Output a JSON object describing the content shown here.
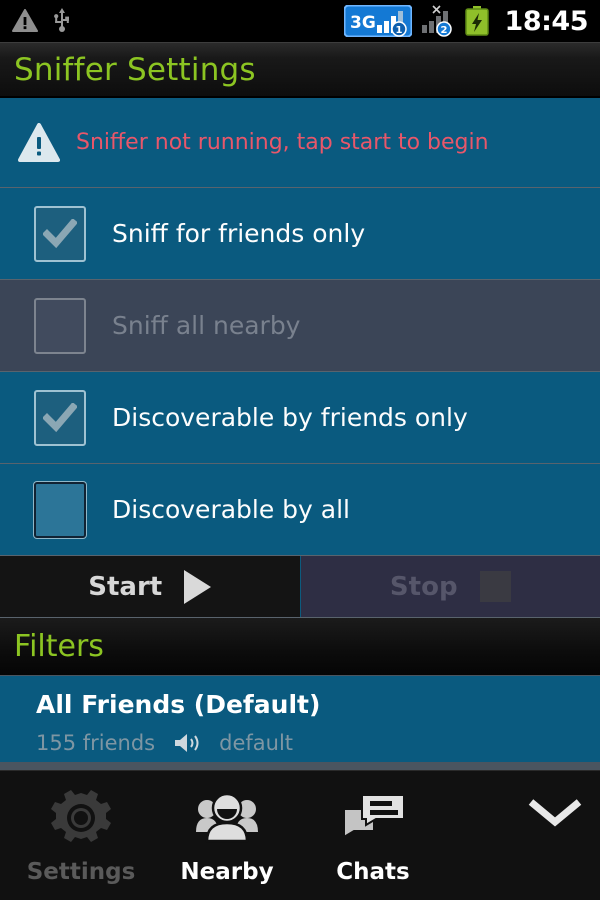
{
  "statusbar": {
    "left_icons": [
      {
        "name": "warning-icon",
        "glyph": "warning-triangle"
      },
      {
        "name": "usb-icon",
        "glyph": "usb"
      }
    ],
    "right_icons": [
      {
        "name": "signal-3g-sim1-icon",
        "label": "3G",
        "sim": "1"
      },
      {
        "name": "signal-sim2-no-service-icon",
        "label": "",
        "sim": "2"
      },
      {
        "name": "battery-charging-icon",
        "label": ""
      }
    ],
    "clock": "18:45"
  },
  "titlebar": {
    "title": "Sniffer Settings",
    "accent_color": "#8cc522"
  },
  "warning_row": {
    "icon": "alert-triangle-icon",
    "message": "Sniffer not running, tap start to begin",
    "color": "#e8576a"
  },
  "options": [
    {
      "id": "sniff-friends-only",
      "label": "Sniff for friends only",
      "checked": true,
      "enabled": true
    },
    {
      "id": "sniff-all-nearby",
      "label": "Sniff all nearby",
      "checked": false,
      "enabled": false
    },
    {
      "id": "discoverable-friends-only",
      "label": "Discoverable by friends only",
      "checked": true,
      "enabled": true
    },
    {
      "id": "discoverable-by-all",
      "label": "Discoverable by all",
      "checked": false,
      "enabled": true
    }
  ],
  "controls": {
    "start_label": "Start",
    "start_enabled": true,
    "stop_label": "Stop",
    "stop_enabled": false
  },
  "filters": {
    "section_title": "Filters",
    "items": [
      {
        "title": "All Friends (Default)",
        "count_text": "155 friends",
        "sound_icon": "speaker-icon",
        "sound_text": "default"
      }
    ]
  },
  "navbar": {
    "items": [
      {
        "id": "settings",
        "label": "Settings",
        "icon": "gear-icon",
        "state": "active"
      },
      {
        "id": "nearby",
        "label": "Nearby",
        "icon": "people-group-icon",
        "state": "normal"
      },
      {
        "id": "chats",
        "label": "Chats",
        "icon": "chat-bubbles-icon",
        "state": "normal"
      }
    ],
    "collapse_icon": "chevron-down-icon"
  },
  "colors": {
    "row_enabled_bg": "#0a5a7f",
    "row_disabled_bg": "#3b4557",
    "accent_green": "#8cc522",
    "warning_red": "#e8576a",
    "page_bg": "#4a5560"
  }
}
